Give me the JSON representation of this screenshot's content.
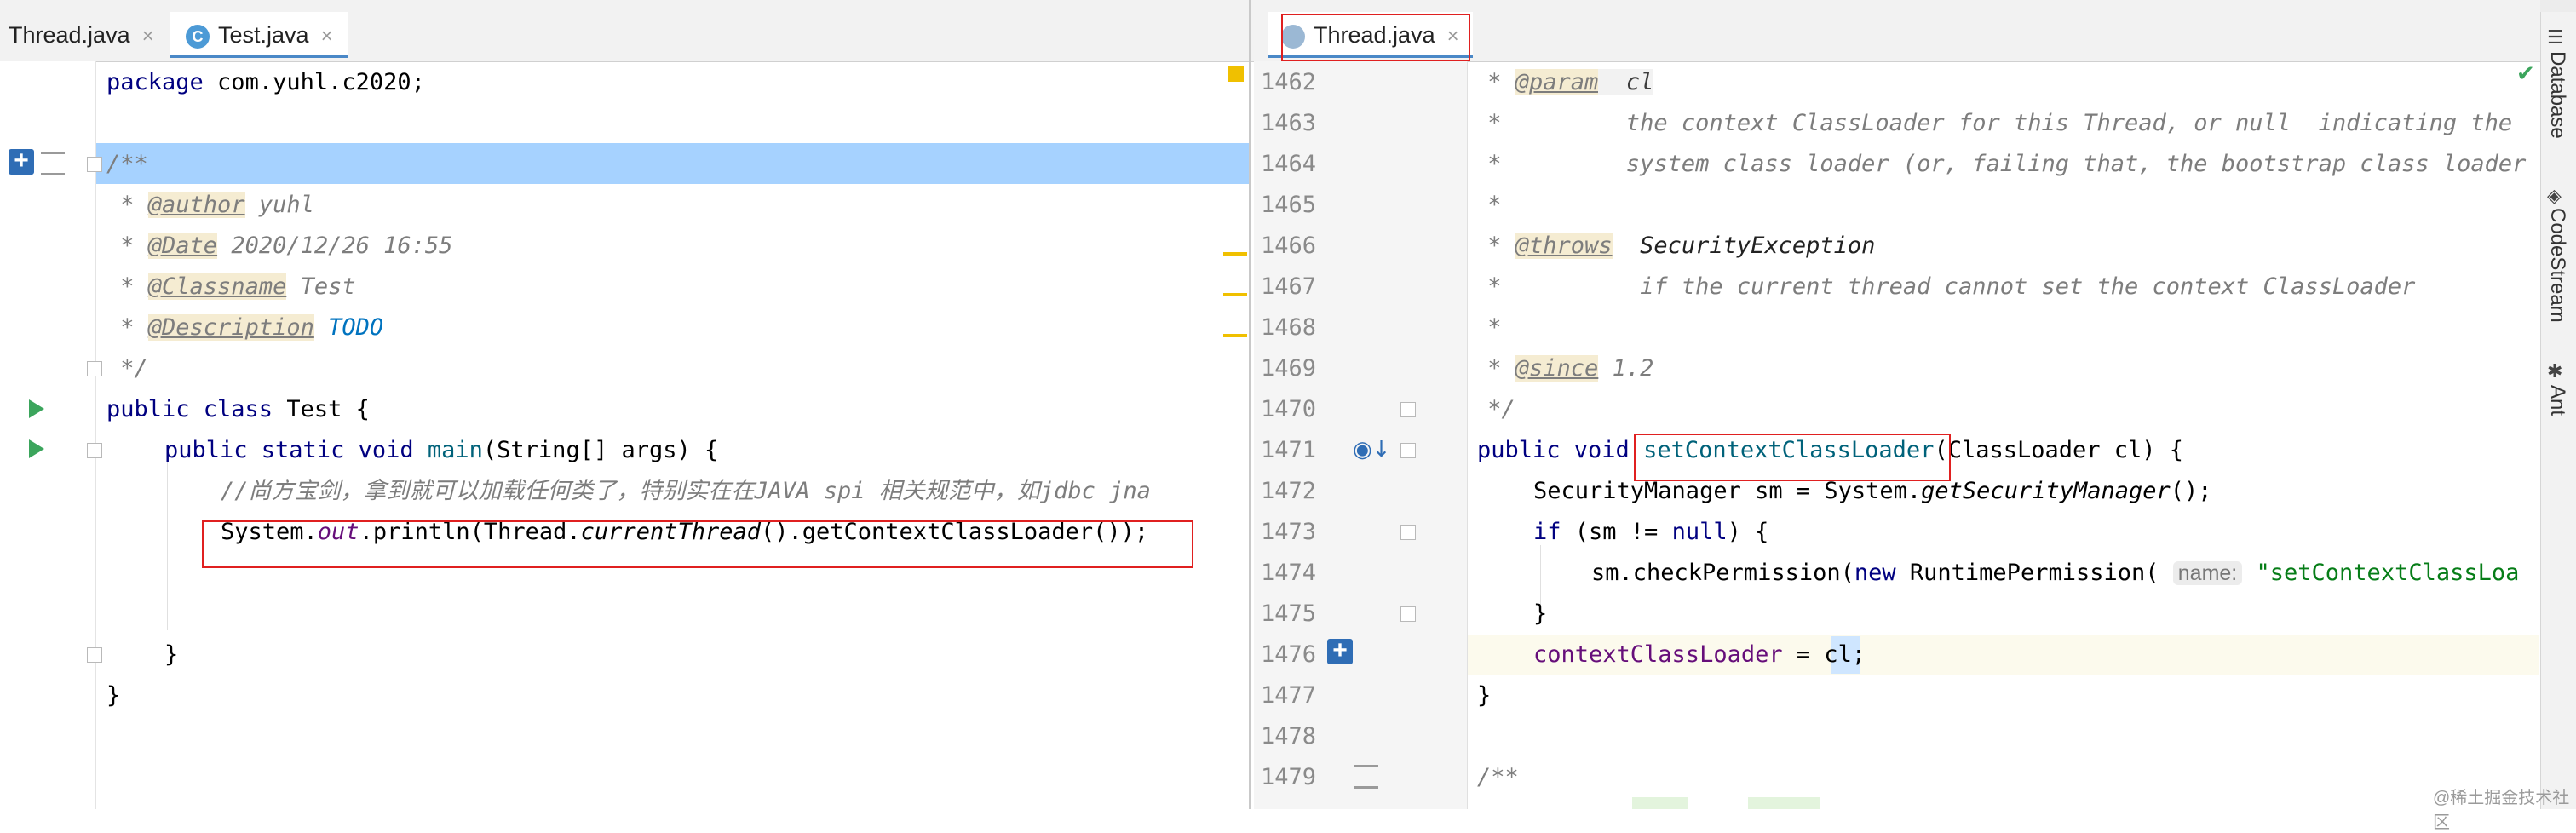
{
  "tabs_left": [
    {
      "label": "Thread.java",
      "close": "×"
    },
    {
      "label": "Test.java",
      "close": "×",
      "icon": "C"
    }
  ],
  "tabs_right": [
    {
      "label": "Thread.java",
      "close": "×"
    }
  ],
  "left_code": {
    "l1": {
      "kw": "package",
      "rest": " com.yuhl.c2020;"
    },
    "l3": "/**",
    "l4": {
      "pre": " * ",
      "tag": "@author",
      "rest": " yuhl"
    },
    "l5": {
      "pre": " * ",
      "tag": "@Date",
      "rest": " 2020/12/26 16:55"
    },
    "l6": {
      "pre": " * ",
      "tag": "@Classname",
      "rest": " Test"
    },
    "l7": {
      "pre": " * ",
      "tag": "@Description",
      "todo": "TODO"
    },
    "l8": " */",
    "l9": {
      "kw": "public class",
      "rest": " Test {"
    },
    "l10": {
      "kw": "public static void",
      "method": "main",
      "rest": "(String[] args) {"
    },
    "l11": "//尚方宝剑，拿到就可以加载任何类了，特别实在在JAVA spi 相关规范中，如jdbc jna",
    "l12": {
      "a": "System.",
      "field": "out",
      "b": ".println(Thread.",
      "ital": "currentThread",
      "c": "().getContextClassLoader());"
    },
    "l15": "}",
    "l16": "}"
  },
  "right_code": {
    "line_numbers": [
      "1462",
      "1463",
      "1464",
      "1465",
      "1466",
      "1467",
      "1468",
      "1469",
      "1470",
      "1471",
      "1472",
      "1473",
      "1474",
      "1475",
      "1476",
      "1477",
      "1478",
      "1479"
    ],
    "r1462": {
      "pre": " * ",
      "tag": "@param",
      "rest": "  cl"
    },
    "r1463": " *         the context ClassLoader for this Thread, or null  indicating the",
    "r1464": " *         system class loader (or, failing that, the bootstrap class loader",
    "r1465": " *",
    "r1466": {
      "pre": " * ",
      "tag": "@throws",
      "rest": "  SecurityException"
    },
    "r1467": " *          if the current thread cannot set the context ClassLoader",
    "r1468": " *",
    "r1469": {
      "pre": " * ",
      "tag": "@since",
      "rest": " 1.2"
    },
    "r1470": " */",
    "r1471": {
      "kw": "public void",
      "method": "setContextClassLoader",
      "rest": "(ClassLoader cl) {"
    },
    "r1472": {
      "a": "SecurityManager sm = System.",
      "ital": "getSecurityManager",
      "b": "();"
    },
    "r1473": {
      "kw": "if",
      "a": " (sm != ",
      "kw2": "null",
      "b": ") {"
    },
    "r1474": {
      "a": "sm.checkPermission(",
      "kw": "new",
      "b": " RuntimePermission(",
      "hint": "name:",
      "str": "\"setContextClassLoa"
    },
    "r1475": "}",
    "r1476": {
      "field": "contextClassLoader",
      "a": " = ",
      "hl": "cl",
      "b": ";"
    },
    "r1477": "}",
    "r1479": "/**"
  },
  "side_panel": [
    "Database",
    "CodeStream",
    "Ant"
  ],
  "watermark": "@稀土掘金技术社区",
  "colors": {
    "keyword": "#000080",
    "comment": "#7d7d7d",
    "selection": "#a6d2ff",
    "red_box": "#e02020",
    "run_icon": "#3ba55c"
  }
}
